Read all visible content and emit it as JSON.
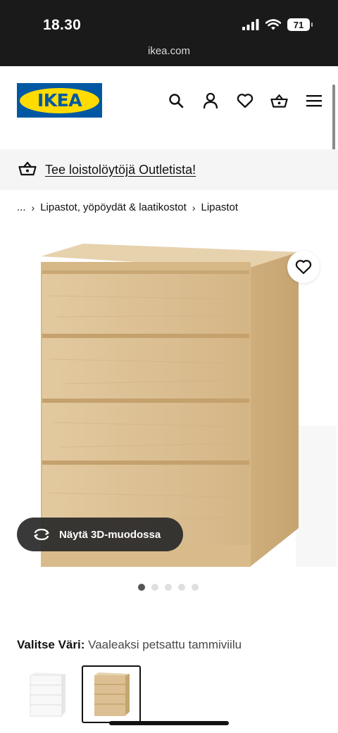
{
  "status_bar": {
    "time": "18.30",
    "battery": "71"
  },
  "browser": {
    "url": "ikea.com"
  },
  "header": {
    "logo_text": "IKEA",
    "icons": [
      "search-icon",
      "account-icon",
      "heart-icon",
      "basket-icon",
      "menu-icon"
    ]
  },
  "promo": {
    "text": "Tee loistolöytöjä Outletista!",
    "icon": "basket-icon"
  },
  "breadcrumb": {
    "items": [
      "...",
      "Lipastot, yöpöydät & laatikostot",
      "Lipastot"
    ],
    "separator": "›"
  },
  "product": {
    "view3d_label": "Näytä 3D-muodossa",
    "carousel": {
      "total": 5,
      "active": 1
    }
  },
  "color": {
    "label": "Valitse Väri:",
    "value": "Vaaleaksi petsattu tammiviilu",
    "swatches": [
      "white",
      "oak"
    ],
    "selected_swatch": "oak"
  },
  "colors": {
    "ikea_blue": "#0058a3",
    "ikea_yellow": "#ffdb00",
    "wood": "#dcc094"
  }
}
